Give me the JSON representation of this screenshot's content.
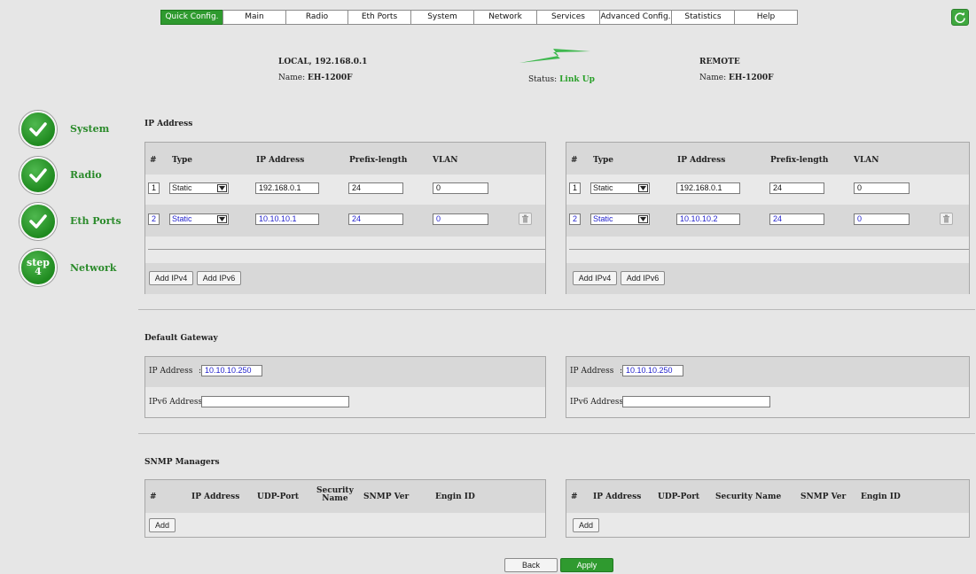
{
  "nav": {
    "tabs": [
      {
        "label": "Quick Config.",
        "active": true
      },
      {
        "label": "Main"
      },
      {
        "label": "Radio"
      },
      {
        "label": "Eth Ports"
      },
      {
        "label": "System"
      },
      {
        "label": "Network"
      },
      {
        "label": "Services"
      },
      {
        "label": "Advanced Config."
      },
      {
        "label": "Statistics"
      },
      {
        "label": "Help"
      }
    ],
    "refresh_icon": "refresh-icon"
  },
  "header": {
    "local_title": "LOCAL, 192.168.0.1",
    "local_name_label": "Name:",
    "local_name": "EH-1200F",
    "status_label": "Status:",
    "status_value": "Link Up",
    "remote_title": "REMOTE",
    "remote_name_label": "Name:",
    "remote_name": "EH-1200F"
  },
  "steps": [
    {
      "label": "System",
      "state": "done"
    },
    {
      "label": "Radio",
      "state": "done"
    },
    {
      "label": "Eth Ports",
      "state": "done"
    },
    {
      "label": "Network",
      "state": "current",
      "badge_top": "step",
      "badge_bottom": "4"
    }
  ],
  "ip_section": {
    "title": "IP Address",
    "headers": {
      "num": "#",
      "type": "Type",
      "ip": "IP Address",
      "prefix": "Prefix-length",
      "vlan": "VLAN"
    },
    "local_rows": [
      {
        "num": "1",
        "type": "Static",
        "ip": "192.168.0.1",
        "prefix": "24",
        "vlan": "0"
      },
      {
        "num": "2",
        "type": "Static",
        "ip": "10.10.10.1",
        "prefix": "24",
        "vlan": "0"
      }
    ],
    "remote_rows": [
      {
        "num": "1",
        "type": "Static",
        "ip": "192.168.0.1",
        "prefix": "24",
        "vlan": "0"
      },
      {
        "num": "2",
        "type": "Static",
        "ip": "10.10.10.2",
        "prefix": "24",
        "vlan": "0"
      }
    ],
    "add_ipv4": "Add IPv4",
    "add_ipv6": "Add IPv6"
  },
  "gateway_section": {
    "title": "Default Gateway",
    "ip_label": "IP Address",
    "ipv6_label": "IPv6 Address :",
    "colon": ":",
    "local_ip": "10.10.10.250",
    "local_ipv6": "",
    "remote_ip": "10.10.10.250",
    "remote_ipv6": ""
  },
  "snmp_section": {
    "title": "SNMP Managers",
    "headers": {
      "num": "#",
      "ip": "IP Address",
      "udp": "UDP-Port",
      "security": "Security Name",
      "security_l1": "Security",
      "security_l2": "Name",
      "ver": "SNMP Ver",
      "engine": "Engin ID"
    },
    "add": "Add"
  },
  "footer": {
    "back": "Back",
    "apply": "Apply"
  },
  "colors": {
    "accent_green": "#2f9a2f",
    "status_green": "#2aa02a",
    "background": "#e6e6e6"
  }
}
